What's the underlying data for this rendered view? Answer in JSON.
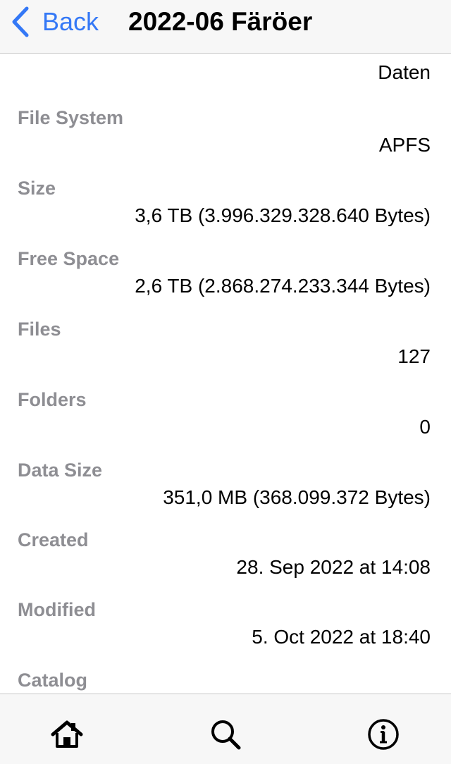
{
  "nav": {
    "back_label": "Back",
    "title": "2022-06 Färöer"
  },
  "volume_name": "Daten",
  "fields": [
    {
      "label": "File System",
      "value": "APFS"
    },
    {
      "label": "Size",
      "value": "3,6 TB (3.996.329.328.640 Bytes)"
    },
    {
      "label": "Free Space",
      "value": "2,6 TB (2.868.274.233.344 Bytes)"
    },
    {
      "label": "Files",
      "value": "127"
    },
    {
      "label": "Folders",
      "value": "0"
    },
    {
      "label": "Data Size",
      "value": "351,0 MB (368.099.372 Bytes)"
    },
    {
      "label": "Created",
      "value": "28. Sep 2022 at 14:08"
    },
    {
      "label": "Modified",
      "value": "5. Oct 2022 at 18:40"
    },
    {
      "label": "Catalog",
      "value": ""
    }
  ],
  "tabbar": {
    "items": [
      {
        "icon": "home-icon"
      },
      {
        "icon": "search-icon"
      },
      {
        "icon": "info-icon"
      }
    ]
  },
  "colors": {
    "accent": "#3478f6",
    "label_gray": "#8e8e93",
    "bar_background": "#f7f7f7"
  }
}
